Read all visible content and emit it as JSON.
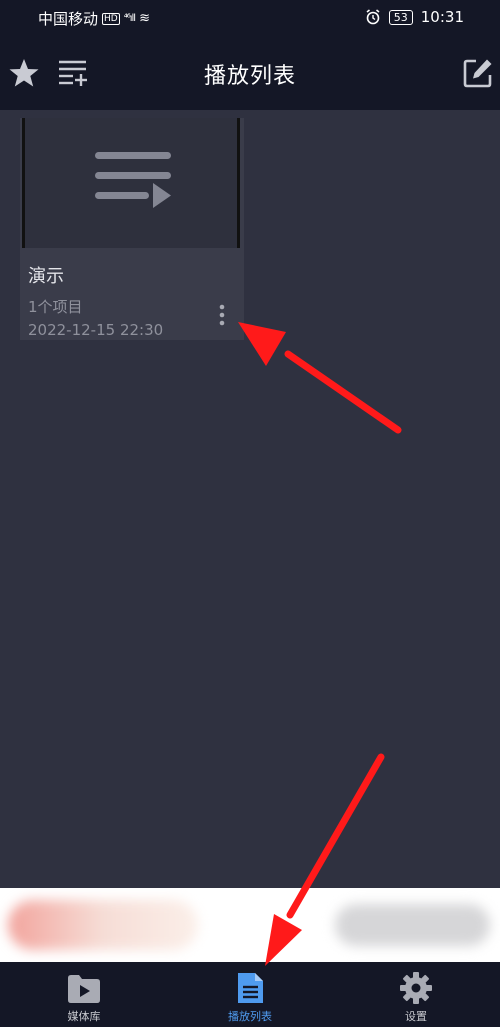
{
  "status_bar": {
    "carrier": "中国移动",
    "hd": "HD",
    "signal": "⁴⁶ıll",
    "battery": "53",
    "time": "10:31"
  },
  "app_bar": {
    "title": "播放列表",
    "icons": [
      "star-icon",
      "add-to-playlist-icon",
      "edit-icon"
    ]
  },
  "playlists": [
    {
      "name": "演示",
      "count": "1个项目",
      "date": "2022-12-15 22:30",
      "icon": "playlist-icon"
    }
  ],
  "bottom_nav": {
    "items": [
      {
        "label": "媒体库",
        "icon": "folder-play-icon",
        "active": false
      },
      {
        "label": "播放列表",
        "icon": "document-list-icon",
        "active": true
      },
      {
        "label": "设置",
        "icon": "gear-icon",
        "active": false
      }
    ]
  },
  "colors": {
    "bar_background": "#141726",
    "content_background": "#2f3140",
    "card_background": "#3a3c4a",
    "accent": "#4f9bef",
    "annotation_arrow": "#ff1a1a"
  }
}
